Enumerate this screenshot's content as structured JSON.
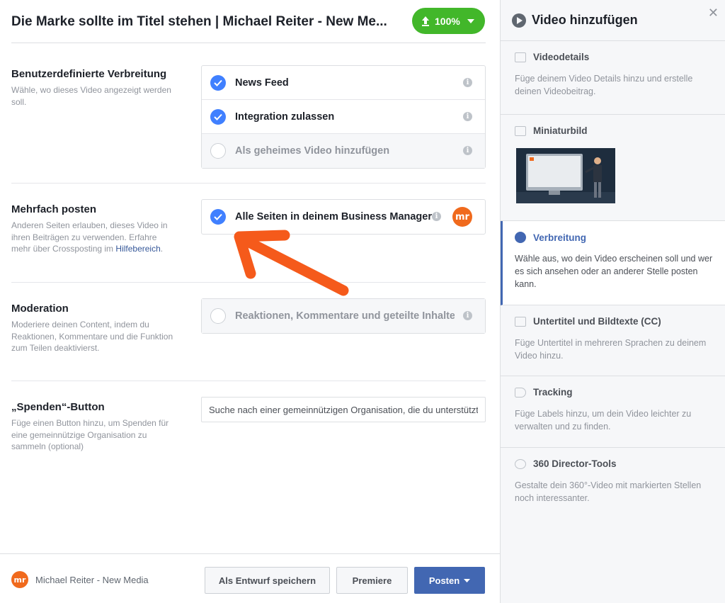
{
  "header": {
    "title": "Die Marke sollte im Titel stehen | Michael Reiter - New Me...",
    "upload_percent": "100%"
  },
  "sections": {
    "distribution": {
      "title": "Benutzerdefinierte Verbreitung",
      "desc": "Wähle, wo dieses Video angezeigt werden soll.",
      "options": [
        {
          "label": "News Feed",
          "checked": true
        },
        {
          "label": "Integration zulassen",
          "checked": true
        },
        {
          "label": "Als geheimes Video hinzufügen",
          "checked": false
        }
      ]
    },
    "crosspost": {
      "title": "Mehrfach posten",
      "desc": "Anderen Seiten erlauben, dieses Video in ihren Beiträgen zu verwenden. Erfahre mehr über Crossposting im",
      "link": "Hilfebereich",
      "option": "Alle Seiten in deinem Business Manager",
      "logo": "mr"
    },
    "moderation": {
      "title": "Moderation",
      "desc": "Moderiere deinen Content, indem du Reaktionen, Kommentare und die Funktion zum Teilen deaktivierst.",
      "option": "Reaktionen, Kommentare und geteilte Inhalte d"
    },
    "donate": {
      "title": "„Spenden“-Button",
      "desc": "Füge einen Button hinzu, um Spenden für eine gemeinnützige Organisation zu sammeln (optional)",
      "placeholder": "Suche nach einer gemeinnützigen Organisation, die du unterstützt"
    }
  },
  "footer": {
    "page_name": "Michael Reiter - New Media",
    "draft": "Als Entwurf speichern",
    "premiere": "Premiere",
    "post": "Posten"
  },
  "sidebar": {
    "title": "Video hinzufügen",
    "steps": [
      {
        "title": "Videodetails",
        "desc": "Füge deinem Video Details hinzu und erstelle deinen Videobeitrag."
      },
      {
        "title": "Miniaturbild",
        "desc": ""
      },
      {
        "title": "Verbreitung",
        "desc": "Wähle aus, wo dein Video erscheinen soll und wer es sich ansehen oder an anderer Stelle posten kann."
      },
      {
        "title": "Untertitel und Bildtexte (CC)",
        "desc": "Füge Untertitel in mehreren Sprachen zu deinem Video hinzu."
      },
      {
        "title": "Tracking",
        "desc": "Füge Labels hinzu, um dein Video leichter zu verwalten und zu finden."
      },
      {
        "title": "360 Director-Tools",
        "desc": "Gestalte dein 360°-Video mit markierten Stellen noch interessanter."
      }
    ]
  },
  "colors": {
    "accent": "#4267b2",
    "check": "#4080ff",
    "upload": "#42b72a",
    "arrow": "#f55a1b"
  }
}
